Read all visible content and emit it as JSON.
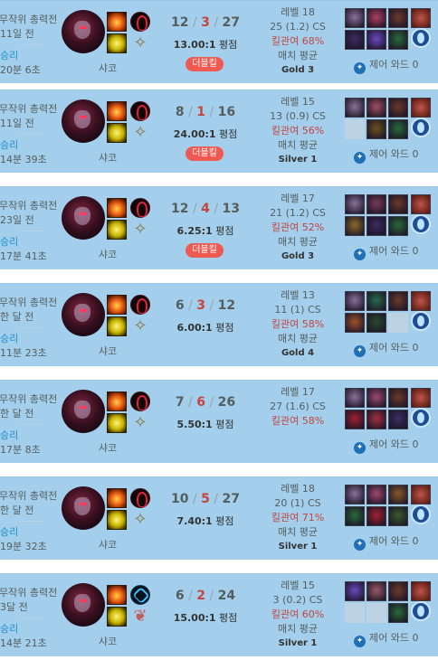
{
  "labels": {
    "ward_prefix": "제어 와드"
  },
  "games": [
    {
      "mode": "무작위 총력전",
      "ago": "11일 전",
      "result": "승리",
      "duration": "20분 6초",
      "champion": "샤코",
      "keystone": "red",
      "kda": {
        "k": "12",
        "d": "3",
        "a": "27"
      },
      "ratio": "13.00:1",
      "ratio_label": "평점",
      "badge": "더블킬",
      "level": "레벨 18",
      "cs": "25 (1.2) CS",
      "kp": "킬관여 68%",
      "avg": "매치 평균",
      "tier": "Gold 3",
      "items": [
        "#8b6f9a",
        "#b04060",
        "#6b3a2a",
        "#3a2a60",
        "#6a4ac0",
        "#2a6a3a"
      ],
      "wards": "0"
    },
    {
      "mode": "무작위 총력전",
      "ago": "11일 전",
      "result": "승리",
      "duration": "14분 39초",
      "champion": "샤코",
      "keystone": "red",
      "kda": {
        "k": "8",
        "d": "1",
        "a": "16"
      },
      "ratio": "24.00:1",
      "ratio_label": "평점",
      "badge": "더블킬",
      "level": "레벨 15",
      "cs": "13 (0.9) CS",
      "kp": "킬관여 56%",
      "avg": "매치 평균",
      "tier": "Silver 1",
      "items": [
        "#8b6f9a",
        "#a05060",
        "#6b3a2a",
        "",
        "#6b5020",
        "#2a6a3a"
      ],
      "wards": "0"
    },
    {
      "mode": "무작위 총력전",
      "ago": "23일 전",
      "result": "승리",
      "duration": "17분 41초",
      "champion": "샤코",
      "keystone": "red",
      "kda": {
        "k": "12",
        "d": "4",
        "a": "13"
      },
      "ratio": "6.25:1",
      "ratio_label": "평점",
      "badge": "더블킬",
      "level": "레벨 17",
      "cs": "21 (1.2) CS",
      "kp": "킬관여 52%",
      "avg": "매치 평균",
      "tier": "Gold 3",
      "items": [
        "#8b6f9a",
        "#7a3a5a",
        "#6b3a2a",
        "#8a6a2a",
        "#3a2a60",
        "#2a6a3a"
      ],
      "wards": "0"
    },
    {
      "mode": "무작위 총력전",
      "ago": "한 달 전",
      "result": "승리",
      "duration": "11분 23초",
      "champion": "샤코",
      "keystone": "red",
      "kda": {
        "k": "6",
        "d": "3",
        "a": "12"
      },
      "ratio": "6.00:1",
      "ratio_label": "평점",
      "badge": "",
      "level": "레벨 13",
      "cs": "11 (1) CS",
      "kp": "킬관여 58%",
      "avg": "매치 평균",
      "tier": "Gold 4",
      "items": [
        "#8b6f9a",
        "#2a6a4a",
        "#6b3a2a",
        "#a0522d",
        "#2a4a30",
        ""
      ],
      "wards": "0"
    },
    {
      "mode": "무작위 총력전",
      "ago": "한 달 전",
      "result": "승리",
      "duration": "17분 8초",
      "champion": "샤코",
      "keystone": "red",
      "kda": {
        "k": "7",
        "d": "6",
        "a": "26"
      },
      "ratio": "5.50:1",
      "ratio_label": "평점",
      "badge": "",
      "level": "레벨 17",
      "cs": "27 (1.6) CS",
      "kp": "킬관여 58%",
      "avg": "",
      "tier": "",
      "items": [
        "#8b6f9a",
        "#9a4a70",
        "#6b3a2a",
        "#a02030",
        "#a03040",
        "#3a3060"
      ],
      "wards": "0"
    },
    {
      "mode": "무작위 총력전",
      "ago": "한 달 전",
      "result": "승리",
      "duration": "19분 32초",
      "champion": "샤코",
      "keystone": "red",
      "kda": {
        "k": "10",
        "d": "5",
        "a": "27"
      },
      "ratio": "7.40:1",
      "ratio_label": "평점",
      "badge": "",
      "level": "레벨 18",
      "cs": "20 (1) CS",
      "kp": "킬관여 71%",
      "avg": "매치 평균",
      "tier": "Silver 1",
      "items": [
        "#8b6f9a",
        "#a04a70",
        "#8a5a2a",
        "#2a6a3a",
        "#a02030",
        "#3a5a2a"
      ],
      "wards": "0"
    },
    {
      "mode": "무작위 총력전",
      "ago": "3달 전",
      "result": "승리",
      "duration": "14분 21초",
      "champion": "샤코",
      "keystone": "blue",
      "kda": {
        "k": "6",
        "d": "2",
        "a": "24"
      },
      "ratio": "15.00:1",
      "ratio_label": "평점",
      "badge": "",
      "level": "레벨 15",
      "cs": "3 (0.2) CS",
      "kp": "킬관여 60%",
      "avg": "매치 평균",
      "tier": "Silver 1",
      "items": [
        "#6a4ac0",
        "#9a5a6a",
        "#6b3a2a",
        "",
        "",
        "#2a6a3a"
      ],
      "wards": "0"
    }
  ]
}
